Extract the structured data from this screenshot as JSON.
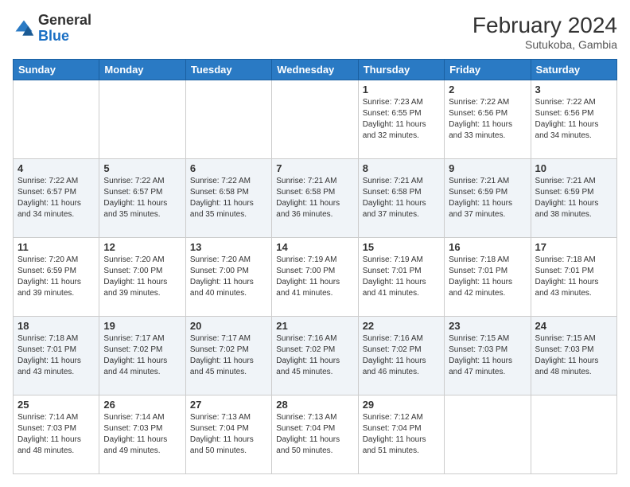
{
  "header": {
    "logo_general": "General",
    "logo_blue": "Blue",
    "month_year": "February 2024",
    "location": "Sutukoba, Gambia"
  },
  "days_of_week": [
    "Sunday",
    "Monday",
    "Tuesday",
    "Wednesday",
    "Thursday",
    "Friday",
    "Saturday"
  ],
  "weeks": [
    [
      {
        "day": "",
        "info": ""
      },
      {
        "day": "",
        "info": ""
      },
      {
        "day": "",
        "info": ""
      },
      {
        "day": "",
        "info": ""
      },
      {
        "day": "1",
        "info": "Sunrise: 7:23 AM\nSunset: 6:55 PM\nDaylight: 11 hours\nand 32 minutes."
      },
      {
        "day": "2",
        "info": "Sunrise: 7:22 AM\nSunset: 6:56 PM\nDaylight: 11 hours\nand 33 minutes."
      },
      {
        "day": "3",
        "info": "Sunrise: 7:22 AM\nSunset: 6:56 PM\nDaylight: 11 hours\nand 34 minutes."
      }
    ],
    [
      {
        "day": "4",
        "info": "Sunrise: 7:22 AM\nSunset: 6:57 PM\nDaylight: 11 hours\nand 34 minutes."
      },
      {
        "day": "5",
        "info": "Sunrise: 7:22 AM\nSunset: 6:57 PM\nDaylight: 11 hours\nand 35 minutes."
      },
      {
        "day": "6",
        "info": "Sunrise: 7:22 AM\nSunset: 6:58 PM\nDaylight: 11 hours\nand 35 minutes."
      },
      {
        "day": "7",
        "info": "Sunrise: 7:21 AM\nSunset: 6:58 PM\nDaylight: 11 hours\nand 36 minutes."
      },
      {
        "day": "8",
        "info": "Sunrise: 7:21 AM\nSunset: 6:58 PM\nDaylight: 11 hours\nand 37 minutes."
      },
      {
        "day": "9",
        "info": "Sunrise: 7:21 AM\nSunset: 6:59 PM\nDaylight: 11 hours\nand 37 minutes."
      },
      {
        "day": "10",
        "info": "Sunrise: 7:21 AM\nSunset: 6:59 PM\nDaylight: 11 hours\nand 38 minutes."
      }
    ],
    [
      {
        "day": "11",
        "info": "Sunrise: 7:20 AM\nSunset: 6:59 PM\nDaylight: 11 hours\nand 39 minutes."
      },
      {
        "day": "12",
        "info": "Sunrise: 7:20 AM\nSunset: 7:00 PM\nDaylight: 11 hours\nand 39 minutes."
      },
      {
        "day": "13",
        "info": "Sunrise: 7:20 AM\nSunset: 7:00 PM\nDaylight: 11 hours\nand 40 minutes."
      },
      {
        "day": "14",
        "info": "Sunrise: 7:19 AM\nSunset: 7:00 PM\nDaylight: 11 hours\nand 41 minutes."
      },
      {
        "day": "15",
        "info": "Sunrise: 7:19 AM\nSunset: 7:01 PM\nDaylight: 11 hours\nand 41 minutes."
      },
      {
        "day": "16",
        "info": "Sunrise: 7:18 AM\nSunset: 7:01 PM\nDaylight: 11 hours\nand 42 minutes."
      },
      {
        "day": "17",
        "info": "Sunrise: 7:18 AM\nSunset: 7:01 PM\nDaylight: 11 hours\nand 43 minutes."
      }
    ],
    [
      {
        "day": "18",
        "info": "Sunrise: 7:18 AM\nSunset: 7:01 PM\nDaylight: 11 hours\nand 43 minutes."
      },
      {
        "day": "19",
        "info": "Sunrise: 7:17 AM\nSunset: 7:02 PM\nDaylight: 11 hours\nand 44 minutes."
      },
      {
        "day": "20",
        "info": "Sunrise: 7:17 AM\nSunset: 7:02 PM\nDaylight: 11 hours\nand 45 minutes."
      },
      {
        "day": "21",
        "info": "Sunrise: 7:16 AM\nSunset: 7:02 PM\nDaylight: 11 hours\nand 45 minutes."
      },
      {
        "day": "22",
        "info": "Sunrise: 7:16 AM\nSunset: 7:02 PM\nDaylight: 11 hours\nand 46 minutes."
      },
      {
        "day": "23",
        "info": "Sunrise: 7:15 AM\nSunset: 7:03 PM\nDaylight: 11 hours\nand 47 minutes."
      },
      {
        "day": "24",
        "info": "Sunrise: 7:15 AM\nSunset: 7:03 PM\nDaylight: 11 hours\nand 48 minutes."
      }
    ],
    [
      {
        "day": "25",
        "info": "Sunrise: 7:14 AM\nSunset: 7:03 PM\nDaylight: 11 hours\nand 48 minutes."
      },
      {
        "day": "26",
        "info": "Sunrise: 7:14 AM\nSunset: 7:03 PM\nDaylight: 11 hours\nand 49 minutes."
      },
      {
        "day": "27",
        "info": "Sunrise: 7:13 AM\nSunset: 7:04 PM\nDaylight: 11 hours\nand 50 minutes."
      },
      {
        "day": "28",
        "info": "Sunrise: 7:13 AM\nSunset: 7:04 PM\nDaylight: 11 hours\nand 50 minutes."
      },
      {
        "day": "29",
        "info": "Sunrise: 7:12 AM\nSunset: 7:04 PM\nDaylight: 11 hours\nand 51 minutes."
      },
      {
        "day": "",
        "info": ""
      },
      {
        "day": "",
        "info": ""
      }
    ]
  ]
}
